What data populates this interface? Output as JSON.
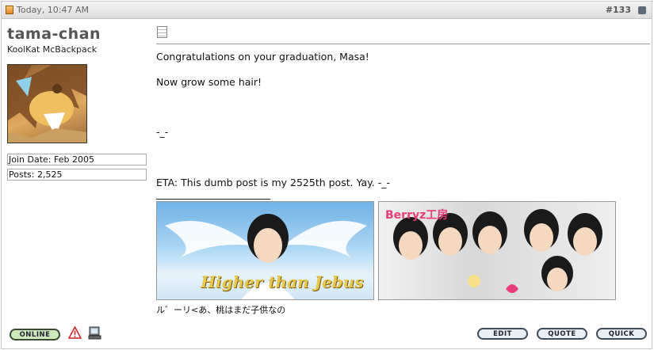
{
  "post": {
    "date": "Today, 10:47 AM",
    "number": "#133",
    "icon": "post-status-icon",
    "collapse_icon": "collapse-icon"
  },
  "user": {
    "name": "tama-chan",
    "title": "KoolKat McBackpack",
    "join_date": "Join Date: Feb 2005",
    "posts": "Posts: 2,525"
  },
  "message": {
    "icon": "message-icon",
    "line1": "Congratulations on your graduation, Masa!",
    "line2": "Now grow some hair!",
    "line3": "-_-",
    "line4": "ETA: This dumb post is my 2525th post. Yay. -_-"
  },
  "signature": {
    "banner_left_text": "Higher than Jebus",
    "banner_right_text": "Berryz工房",
    "caption": "ル゛ーリ<あ、桃はまだ子供なの"
  },
  "buttons": {
    "online": "ONLINE",
    "edit": "EDIT",
    "quote": "QUOTE",
    "quick": "QUICK"
  },
  "colors": {
    "header_bg": "#dedede",
    "online_bg": "#cdeabd",
    "button_bg": "#e8eef4",
    "banner_text": "#e8c84a",
    "brand_pink": "#e83c7a"
  }
}
